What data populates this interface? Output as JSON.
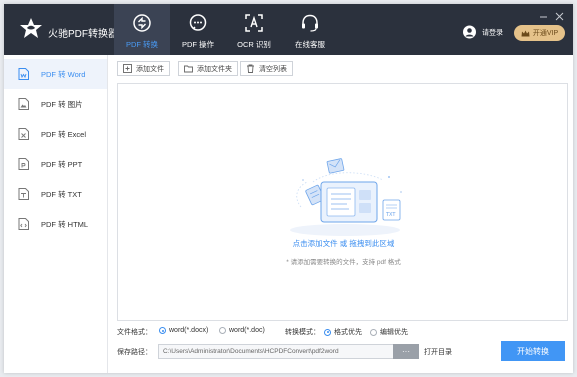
{
  "app": {
    "title": "火驰PDF转换器"
  },
  "nav": [
    {
      "label": "PDF 转换",
      "icon": "convert-icon",
      "active": true
    },
    {
      "label": "PDF 操作",
      "icon": "chat-icon",
      "active": false
    },
    {
      "label": "OCR 识别",
      "icon": "ocr-icon",
      "active": false
    },
    {
      "label": "在线客服",
      "icon": "headset-icon",
      "active": false
    }
  ],
  "user": {
    "login_label": "请登录",
    "vip_label": "开通VIP"
  },
  "sidebar": {
    "items": [
      {
        "label": "PDF 转 Word",
        "active": true
      },
      {
        "label": "PDF 转 图片",
        "active": false
      },
      {
        "label": "PDF 转 Excel",
        "active": false
      },
      {
        "label": "PDF 转 PPT",
        "active": false
      },
      {
        "label": "PDF 转 TXT",
        "active": false
      },
      {
        "label": "PDF 转 HTML",
        "active": false
      }
    ]
  },
  "toolbar": {
    "add_file": "添加文件",
    "add_folder": "添加文件夹",
    "clear_list": "清空列表"
  },
  "dropzone": {
    "main_text": "点击添加文件 或 拖拽到此区域",
    "sub_text": "* 请添加需要转换的文件，支持 pdf 格式",
    "illustration_badge": "TXT"
  },
  "options": {
    "format_label": "文件格式：",
    "format_options": [
      {
        "label": "word(*.docx)",
        "checked": true
      },
      {
        "label": "word(*.doc)",
        "checked": false
      }
    ],
    "mode_label": "转换模式：",
    "mode_options": [
      {
        "label": "格式优先",
        "checked": true
      },
      {
        "label": "编辑优先",
        "checked": false
      }
    ],
    "path_label": "保存路径：",
    "path_value": "C:\\Users\\Administrator\\Documents\\HCPDFConvert\\pdf2word",
    "browse_label": "···",
    "open_dir_label": "打开目录",
    "start_label": "开始转换"
  },
  "colors": {
    "titlebar": "#2b313d",
    "accent": "#3b8ef0",
    "vip": "#e5c28a"
  }
}
